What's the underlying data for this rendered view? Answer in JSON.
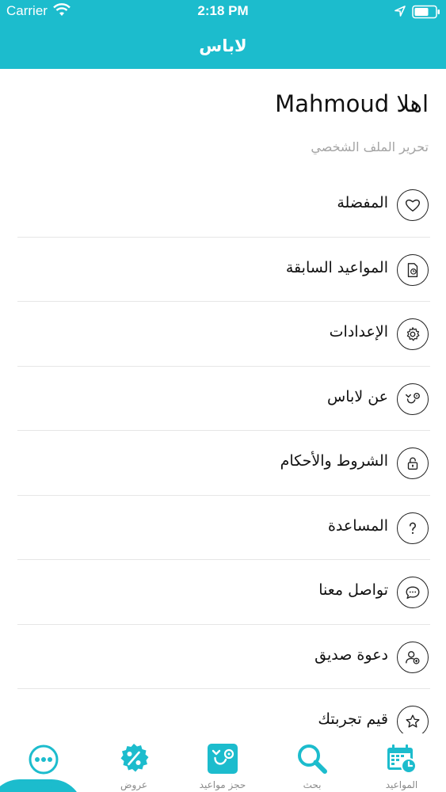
{
  "status_bar": {
    "carrier": "Carrier",
    "time": "2:18 PM"
  },
  "nav": {
    "title": "لاباس"
  },
  "profile": {
    "greeting": "اهلا Mahmoud",
    "edit_link": "تحرير الملف الشخصي"
  },
  "menu": {
    "items": [
      {
        "label": "المفضلة",
        "icon": "heart-icon"
      },
      {
        "label": "المواعيد السابقة",
        "icon": "document-clock-icon"
      },
      {
        "label": "الإعدادات",
        "icon": "gear-icon"
      },
      {
        "label": "عن لاباس",
        "icon": "stethoscope-icon"
      },
      {
        "label": "الشروط والأحكام",
        "icon": "lock-icon"
      },
      {
        "label": "المساعدة",
        "icon": "question-icon"
      },
      {
        "label": "تواصل معنا",
        "icon": "chat-icon"
      },
      {
        "label": "دعوة صديق",
        "icon": "add-user-icon"
      },
      {
        "label": "قيم تجربتك",
        "icon": "star-icon"
      }
    ]
  },
  "tabs": {
    "appointments": "المواعيد",
    "search": "بحث",
    "book": "حجز مواعيد",
    "offers": "عروض",
    "more": "المزيد"
  },
  "colors": {
    "accent": "#1cbccd"
  }
}
